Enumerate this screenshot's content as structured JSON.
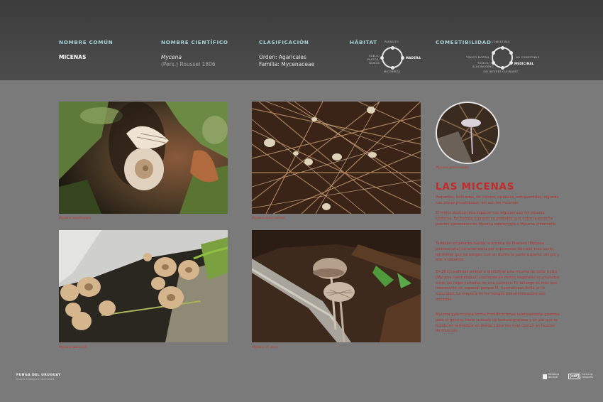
{
  "header": {
    "common_name": {
      "label": "NOMBRE COMÚN",
      "value": "MICENAS"
    },
    "scientific_name": {
      "label": "NOMBRE CIENTÍFICO",
      "genus": "Mycena",
      "authority": "(Pers.) Roussel 1806"
    },
    "classification": {
      "label": "CLASIFICACIÓN",
      "order": "Orden: Agaricales",
      "family": "Familia: Mycenaceae"
    },
    "habitat": {
      "label": "HÁBITAT",
      "top": "PARÁSITO",
      "right": "MADERA",
      "bottom": "MICORRIZA",
      "left": "SUELO/ PASTOS/ HUMUS",
      "highlighted": "MADERA"
    },
    "edibility": {
      "label": "COMESTIBILIDAD",
      "top": "COMESTIBLE",
      "left_top": "TÓXICO MORTAL",
      "right_top": "NO COMESTIBLE",
      "left_bottom": "TÓXICO/ ALUCINÓGENO",
      "right_bottom": "MEDICINAL",
      "bottom": "SIN INTERÉS CULINARIO",
      "highlighted": "MEDICINAL"
    }
  },
  "photos": [
    {
      "caption": "Mycena epipterygia"
    },
    {
      "caption": "Mycena pura cornea"
    },
    {
      "caption": "Mycena abramsii"
    },
    {
      "caption": "Mycena cf. pura"
    }
  ],
  "circle_caption": "Mycena galericulata",
  "article": {
    "title": "LAS MICENAS",
    "paragraphs": [
      "Pequeñas, delicadas, de colores variables, extravertidas, algunas con olores penetrantes, así son las micenas.",
      "El mejor destino para topárse con algunas son los pinares costeros. En tiempo húmedo es probable que entre la pinocha pululen ejemplares de Mycena epipterygia o Mycena chlorinella.",
      "También en pinares habita la micena de Pearson (Mycena pearsoniana) caracterizada por esporomas de color rosa sucio, laminillas que convergen con un diente la parte superior del pie y olor a rábanito.",
      "En 2021 pudimos avistar e identificar una micena de color rojizo (Mycena haematopus) creciendo en restos vegetales acumulados entre las hojas cortadas de una palmera. El hallazgo es más que interesante en especial porque M. haematopus brilla en la oscuridad. La mayoría de los hongos bioluminiscentes son micenas.",
      "Mycena galericulata forma fructificaciones relativamente grandes para el género, tiene cutícula de textura granosa y un pie que se hunde en la madera en donde crece (es muy común en huecos de troncos)."
    ]
  },
  "footer": {
    "title": "FUNGA DEL URUGUAY",
    "subtitle": "Nuevos hallazgos e identidades",
    "logo_a": "Biblioteca Nacional",
    "logo_b_mark": "[cdf]",
    "logo_b_text": "Centro de Fotografía"
  },
  "colors": {
    "header_bg": "#444444",
    "page_bg": "#7a7a7a",
    "label_teal": "#a7d2d5",
    "accent_red": "#c62a2a"
  }
}
